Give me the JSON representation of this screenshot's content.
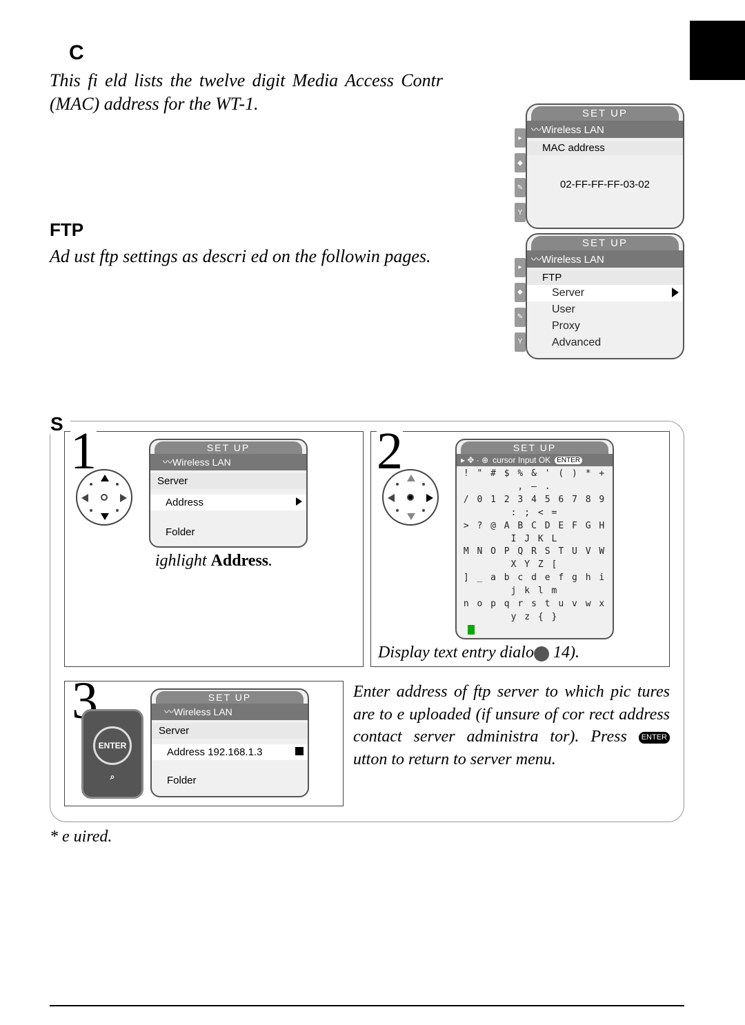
{
  "sections": {
    "mac": {
      "letter": "C",
      "intro": "This fi eld lists the twelve digit Media Access Contr (MAC) address for the WT-1.",
      "screen": {
        "title": "SET  UP",
        "sub": "Wireless LAN",
        "row_label": "MAC address",
        "value": "02-FF-FF-FF-03-02"
      }
    },
    "ftp": {
      "heading": "FTP",
      "intro": "Ad ust ftp settings as descri ed on the followin pages.",
      "screen": {
        "title": "SET  UP",
        "sub": "Wireless LAN",
        "section": "FTP",
        "items": [
          "Server",
          "User",
          "Proxy",
          "Advanced"
        ]
      }
    },
    "server": {
      "letter": "S",
      "step1": {
        "num": "1",
        "caption_pre": "ighlight ",
        "caption_bold": "Address",
        "caption_post": ".",
        "screen": {
          "title": "SET  UP",
          "sub": "Wireless LAN",
          "section": "Server",
          "rows": [
            {
              "label": "Address",
              "sel": true
            },
            {
              "label": "Folder",
              "sel": false
            }
          ]
        }
      },
      "step2": {
        "num": "2",
        "caption_pre": "Display text entry dialo",
        "caption_post": " 14).",
        "screen": {
          "title": "SET  UP",
          "hints": "cursor    Input       OK",
          "lines": [
            "! \" # $ % & ' ( ) * + , – .",
            "/ 0 1 2 3 4 5 6 7 8 9 : ; < =",
            "> ? @ A B C D E F G H I J K L",
            "M N O P Q R S T U V W X Y Z [",
            "] _ a b c d e f g h i j k l m",
            "n o p q r s t u v w x y z { }"
          ]
        }
      },
      "step3": {
        "num": "3",
        "text_a": "Enter address of ftp server to which pic tures are to  e uploaded (if unsure of cor rect address  contact server administra tor).  Press ",
        "text_b": "  utton to return to server menu.",
        "screen": {
          "title": "SET  UP",
          "sub": "Wireless LAN",
          "section": "Server",
          "rows": [
            {
              "label": "Address",
              "value": "192.168.1.3",
              "sel": true
            },
            {
              "label": "Folder",
              "value": "",
              "sel": false
            }
          ]
        },
        "enter_label": "ENTER"
      },
      "footnote": "*  e uired."
    }
  }
}
